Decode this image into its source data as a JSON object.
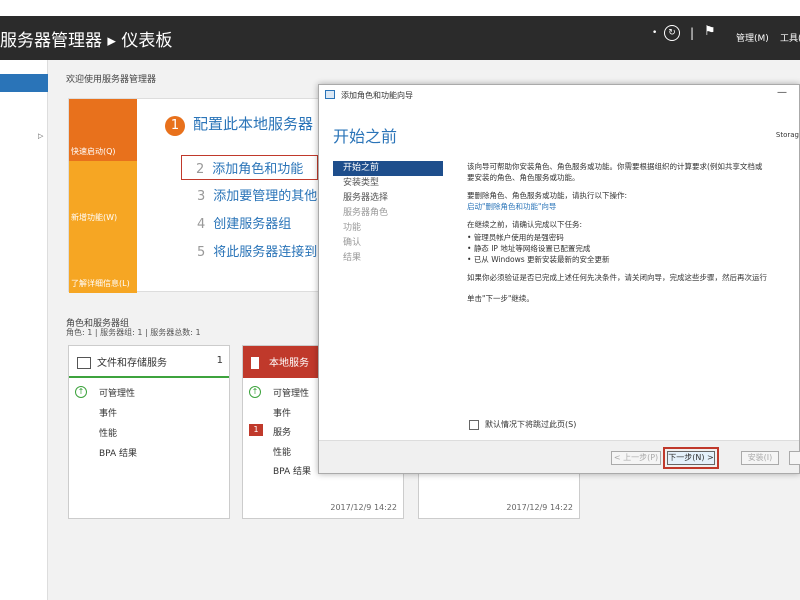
{
  "header": {
    "title": "服务器管理器 ▸ 仪表板",
    "manage_label": "管理(M)",
    "tools_label": "工具(",
    "refresh_icon": "refresh-icon",
    "flag_icon": "flag-icon"
  },
  "main": {
    "welcome": "欢迎使用服务器管理器",
    "quick_start": {
      "tiles": [
        "快速启动(Q)",
        "新增功能(W)",
        "了解详细信息(L)"
      ],
      "steps": [
        {
          "num": "1",
          "label": "配置此本地服务器"
        },
        {
          "num": "2",
          "label": "添加角色和功能"
        },
        {
          "num": "3",
          "label": "添加要管理的其他"
        },
        {
          "num": "4",
          "label": "创建服务器组"
        },
        {
          "num": "5",
          "label": "将此服务器连接到"
        }
      ]
    },
    "roles_section": {
      "title": "角色和服务器组",
      "subtitle": "角色: 1 | 服务器组: 1 | 服务器总数: 1"
    },
    "cards": [
      {
        "title": "文件和存储服务",
        "count": "1",
        "rows": [
          "可管理性",
          "事件",
          "性能",
          "BPA 结果"
        ]
      },
      {
        "title": "本地服务",
        "badge": "1",
        "rows": [
          "可管理性",
          "事件",
          "服务",
          "性能",
          "BPA 结果"
        ],
        "timestamp": "2017/12/9 14:22"
      },
      {
        "timestamp": "2017/12/9 14:22"
      }
    ]
  },
  "dialog": {
    "title": "添加角色和功能向导",
    "heading": "开始之前",
    "server_label": "Storag",
    "nav": [
      {
        "label": "开始之前",
        "state": "active"
      },
      {
        "label": "安装类型",
        "state": "enabled"
      },
      {
        "label": "服务器选择",
        "state": "enabled"
      },
      {
        "label": "服务器角色",
        "state": "disabled"
      },
      {
        "label": "功能",
        "state": "disabled"
      },
      {
        "label": "确认",
        "state": "disabled"
      },
      {
        "label": "结果",
        "state": "disabled"
      }
    ],
    "content": {
      "p1_line1": "该向导可帮助你安装角色、角色服务或功能。你需要根据组织的计算要求(例如共享文档或",
      "p1_line2": "要安装的角色、角色服务或功能。",
      "p2": "要删除角色、角色服务或功能，请执行以下操作:",
      "link": "启动\"删除角色和功能\"向导",
      "p3": "在继续之前，请确认完成以下任务:",
      "bullets": [
        "管理员帐户使用的是强密码",
        "静态 IP 地址等网络设置已配置完成",
        "已从 Windows 更新安装最新的安全更新"
      ],
      "p4": "如果你必须验证是否已完成上述任何先决条件，请关闭向导，完成这些步骤，然后再次运行",
      "p5": "单击\"下一步\"继续。"
    },
    "checkbox_label": "默认情况下将跳过此页(S)",
    "buttons": {
      "prev": "< 上一步(P)",
      "next": "下一步(N) >",
      "install": "安装(I)",
      "cancel": ""
    }
  }
}
